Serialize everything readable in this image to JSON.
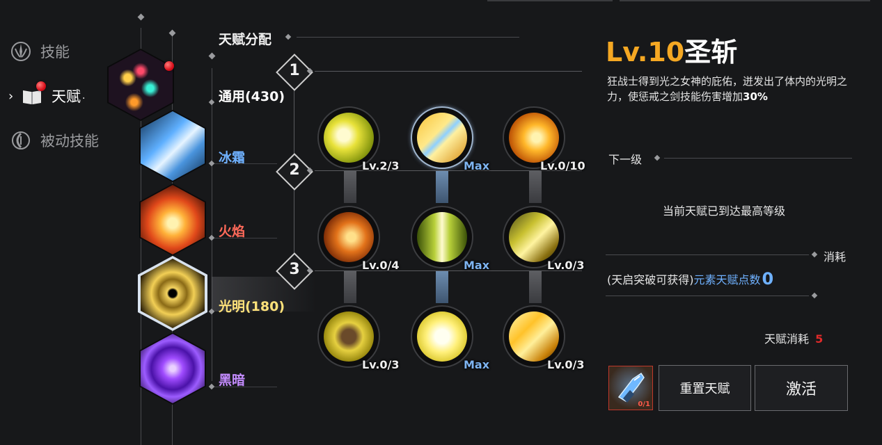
{
  "nav": {
    "items": [
      {
        "label": "技能",
        "icon": "skill-emblem-icon",
        "active": false
      },
      {
        "label": "天赋",
        "icon": "talent-book-icon",
        "active": true
      },
      {
        "label": "被动技能",
        "icon": "passive-swirl-icon",
        "active": false
      }
    ]
  },
  "talent_header": "天赋分配",
  "categories": [
    {
      "label": "通用(430)",
      "color": "#ffffff"
    },
    {
      "label": "冰霜",
      "color": "#6fb1ff"
    },
    {
      "label": "火焰",
      "color": "#ff6a5a"
    },
    {
      "label": "光明(180)",
      "color": "#ffe27a"
    },
    {
      "label": "黑暗",
      "color": "#c48cff"
    }
  ],
  "tiers": [
    "1",
    "2",
    "3"
  ],
  "skills": [
    {
      "level": "Lv.2/3",
      "max": false
    },
    {
      "level": "Max",
      "max": true
    },
    {
      "level": "Lv.0/10",
      "max": false
    },
    {
      "level": "Lv.0/4",
      "max": false
    },
    {
      "level": "Max",
      "max": true
    },
    {
      "level": "Lv.0/3",
      "max": false
    },
    {
      "level": "Lv.0/3",
      "max": false
    },
    {
      "level": "Max",
      "max": true
    },
    {
      "level": "Lv.0/3",
      "max": false
    }
  ],
  "detail": {
    "level": "Lv.10",
    "name": "圣斩",
    "description_prefix": "狂战士得到光之女神的庇佑，迸发出了体内的光明之力，使惩戒之剑技能伤害增加",
    "description_value": "30%",
    "next_level_label": "下一级",
    "max_message": "当前天赋已到达最高等级",
    "cost_label": "消耗",
    "source_text": "(天启突破可获得)",
    "element_points_label": "元素天赋点数",
    "element_points_value": "0",
    "talent_cost_label": "天赋消耗",
    "talent_cost_value": "5",
    "item_count": "0/1"
  },
  "buttons": {
    "reset": "重置天赋",
    "activate": "激活"
  },
  "colors": {
    "accent_level": "#f5a823",
    "points_blue": "#6fb1ff",
    "cost_red": "#e02a2a"
  }
}
